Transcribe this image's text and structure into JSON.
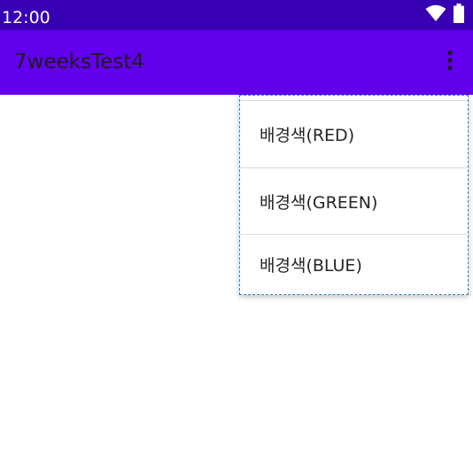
{
  "status_bar": {
    "time": "12:00",
    "icons": [
      "wifi-icon",
      "battery-icon"
    ],
    "color": "#3700b3"
  },
  "app_bar": {
    "title": "7weeksTest4",
    "color": "#6200ee",
    "overflow_icon": "more-vert-icon"
  },
  "menu": {
    "items": [
      {
        "label": "배경색(RED)"
      },
      {
        "label": "배경색(GREEN)"
      },
      {
        "label": "배경색(BLUE)"
      }
    ]
  }
}
